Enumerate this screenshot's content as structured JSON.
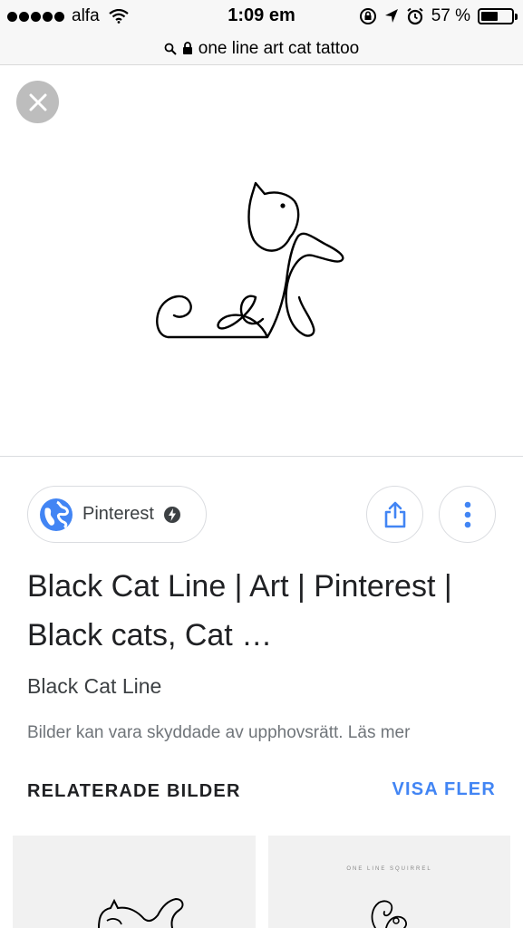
{
  "status_bar": {
    "carrier": "alfa",
    "time": "1:09 em",
    "battery_percent": "57 %",
    "battery_level": 0.57
  },
  "address_bar": {
    "query": "one line art cat tattoo"
  },
  "source_chip": {
    "label": "Pinterest"
  },
  "result": {
    "title": "Black Cat Line | Art | Pinterest | Black cats, Cat …",
    "subtitle": "Black Cat Line",
    "copyright_notice": "Bilder kan vara skyddade av upphovsrätt. Läs mer"
  },
  "related": {
    "header": "RELATERADE BILDER",
    "show_more": "VISA FLER",
    "thumbnails": [
      {
        "caption": ""
      },
      {
        "caption": "ONE LINE SQUIRREL"
      }
    ]
  },
  "colors": {
    "accent_blue": "#4285f4",
    "close_button_bg": "#bdbdbd"
  },
  "icons": [
    "wifi-icon",
    "lock-rotation-icon",
    "location-icon",
    "alarm-icon",
    "battery-icon",
    "search-icon",
    "lock-icon",
    "close-icon",
    "globe-icon",
    "amp-bolt-icon",
    "share-icon",
    "more-vertical-icon"
  ]
}
